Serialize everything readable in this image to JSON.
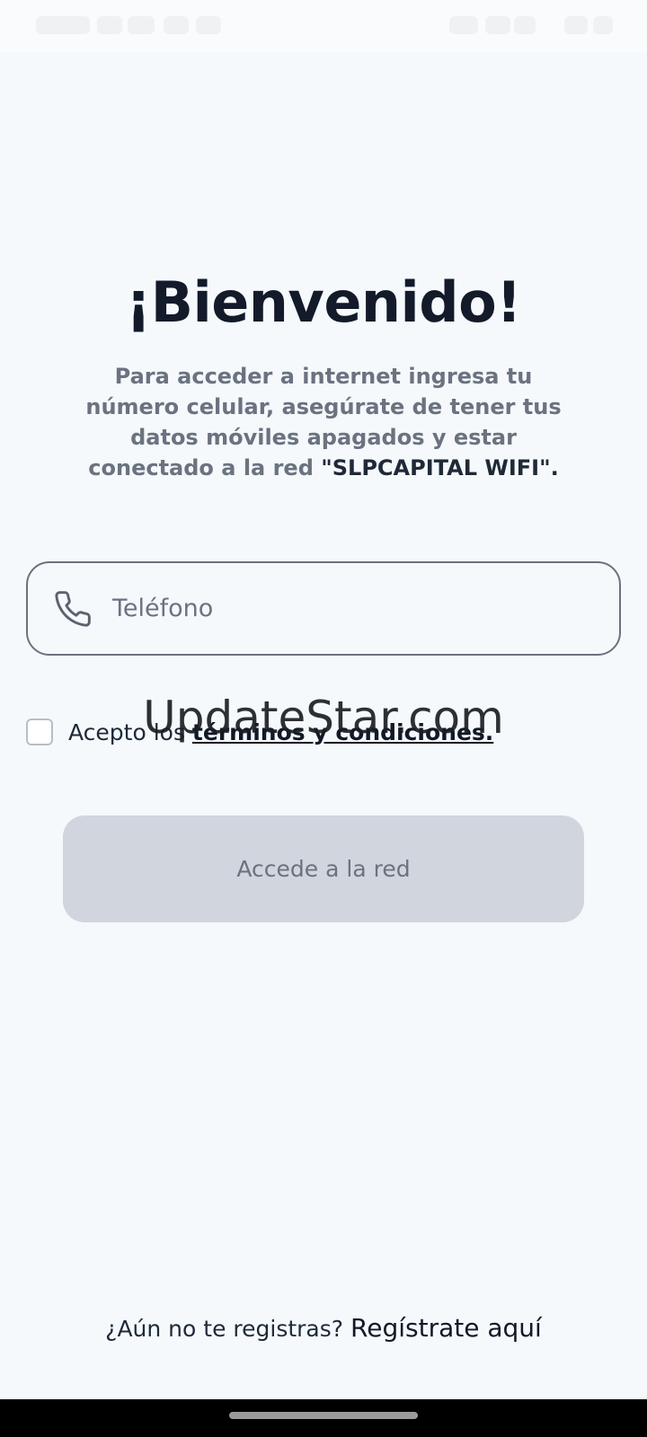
{
  "header": {
    "title": "¡Bienvenido!",
    "subtitle": "Para acceder a internet ingresa tu número celular, asegúrate de tener tus datos móviles apagados y estar conectado a la red",
    "network_name": "\"SLPCAPITAL WIFI\"."
  },
  "form": {
    "phone_placeholder": "Teléfono",
    "phone_icon": "phone-icon",
    "terms_prefix": "Acepto los",
    "terms_link": "términos y condiciones.",
    "submit_label": "Accede a la red"
  },
  "footer": {
    "register_prompt": "¿Aún no te registras?",
    "register_link": "Regístrate aquí"
  },
  "watermark": "UpdateStar.com",
  "colors": {
    "background": "#f5f9fc",
    "title": "#131a2a",
    "muted_text": "#6b7280",
    "button_disabled": "#d1d5de",
    "field_border": "#6b7280"
  }
}
